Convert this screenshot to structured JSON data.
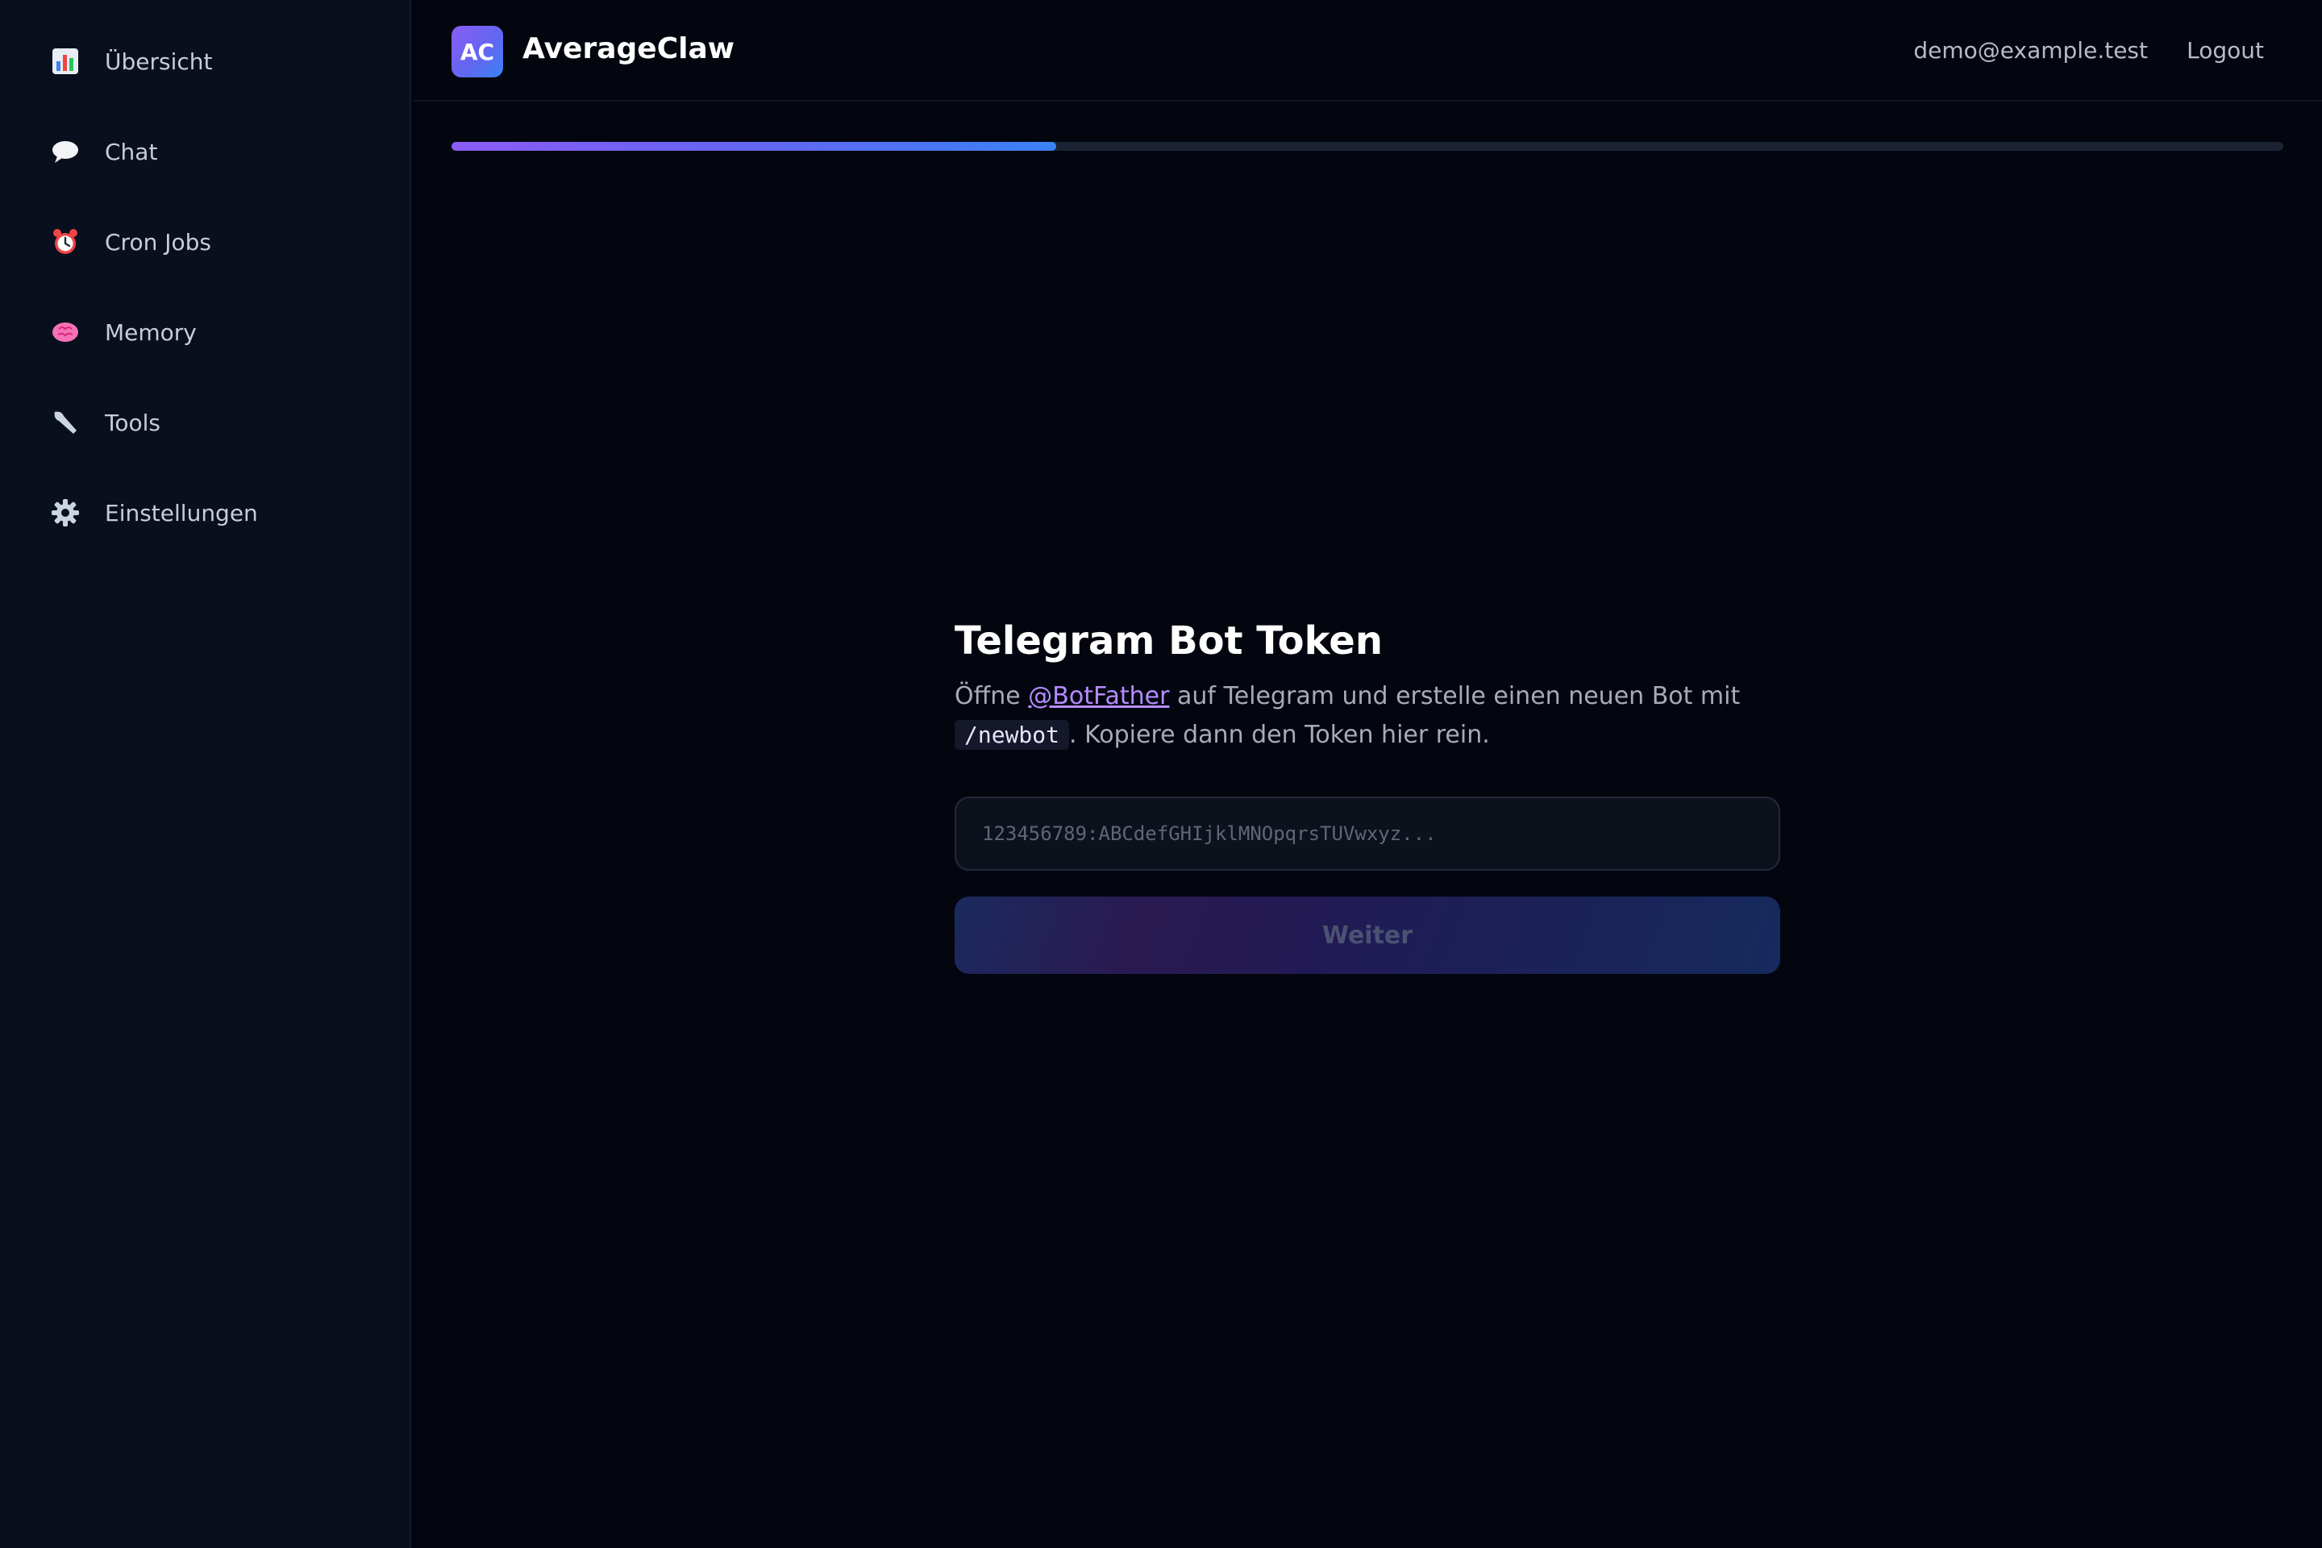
{
  "sidebar": {
    "items": [
      {
        "label": "Übersicht",
        "icon": "bar-chart-icon"
      },
      {
        "label": "Chat",
        "icon": "speech-bubble-icon"
      },
      {
        "label": "Cron Jobs",
        "icon": "alarm-clock-icon"
      },
      {
        "label": "Memory",
        "icon": "brain-icon"
      },
      {
        "label": "Tools",
        "icon": "wrench-icon"
      },
      {
        "label": "Einstellungen",
        "icon": "gear-icon"
      }
    ]
  },
  "header": {
    "logo_text": "AC",
    "app_name": "AverageClaw",
    "user_email": "demo@example.test",
    "logout_label": "Logout"
  },
  "progress": {
    "percent": 33,
    "colors": [
      "#8b5cf6",
      "#3b82f6"
    ]
  },
  "step": {
    "title": "Telegram Bot Token",
    "desc_prefix": "Öffne ",
    "desc_link": "@BotFather",
    "desc_middle": " auf Telegram und erstelle einen neuen Bot mit ",
    "desc_code": "/newbot",
    "desc_suffix": ". Kopiere dann den Token hier rein.",
    "input": {
      "value": "",
      "placeholder": "123456789:ABCdefGHIjklMNOpqrsTUVwxyz..."
    },
    "next_label": "Weiter"
  },
  "colors": {
    "background": "#03060f",
    "sidebar": "#0a0f1d",
    "accent": "#8b5cf6",
    "link": "#b58cff"
  }
}
